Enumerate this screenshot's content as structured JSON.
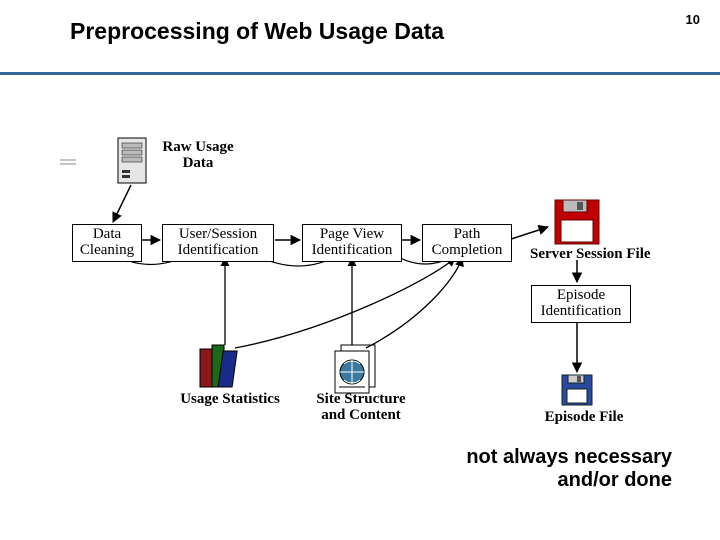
{
  "header": {
    "title": "Preprocessing of Web Usage Data",
    "page_number": "10"
  },
  "nodes": {
    "raw_usage": "Raw Usage\nData",
    "data_cleaning": "Data\nCleaning",
    "user_session": "User/Session\nIdentification",
    "page_view": "Page View\nIdentification",
    "path_completion": "Path\nCompletion",
    "server_session_file": "Server Session File",
    "episode_id": "Episode\nIdentification",
    "usage_stats": "Usage Statistics",
    "site_structure": "Site Structure\nand Content",
    "episode_file": "Episode File"
  },
  "footnote": "not always necessary\nand/or done",
  "colors": {
    "rule": "#336699",
    "floppy_red": "#c00000",
    "floppy_blue": "#2a4aa0"
  }
}
